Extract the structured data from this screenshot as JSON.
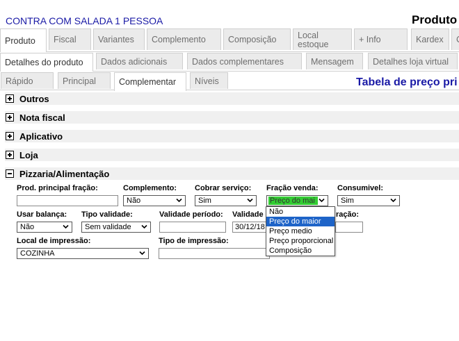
{
  "header": {
    "product_name": "CONTRA COM SALADA 1 PESSOA",
    "title": "Produto"
  },
  "main_tabs": [
    "Produto",
    "Fiscal",
    "Variantes",
    "Complemento",
    "Composição",
    "Local estoque",
    "+ Info",
    "Kardex",
    "C"
  ],
  "detail_tabs": [
    "Detalhes do produto",
    "Dados adicionais",
    "Dados complementares",
    "Mensagem",
    "Detalhes loja virtual"
  ],
  "sub_tabs": [
    "Rápido",
    "Principal",
    "Complementar",
    "Níveis"
  ],
  "price_table_title": "Tabela de preço pri",
  "sections": [
    "Outros",
    "Nota fiscal",
    "Aplicativo",
    "Loja",
    "Pizzaria/Alimentação"
  ],
  "pizzaria": {
    "labels": {
      "prod_principal_fracao": "Prod. principal fração:",
      "complemento": "Complemento:",
      "cobrar_servico": "Cobrar serviço:",
      "fracao_venda": "Fração venda:",
      "consumivel": "Consumivel:",
      "usar_balanca": "Usar balança:",
      "tipo_validade": "Tipo validade:",
      "validade_periodo": "Validade período:",
      "validade": "Validade",
      "geracao": "ração:",
      "local_impressao": "Local de impressão:",
      "tipo_impressao": "Tipo de impressão:"
    },
    "values": {
      "prod_principal_fracao": "",
      "complemento": "Não",
      "cobrar_servico": "Sim",
      "fracao_venda": "Preço do mai",
      "consumivel": "Sim",
      "usar_balanca": "Não",
      "tipo_validade": "Sem validade",
      "validade_periodo": "",
      "validade": "30/12/18",
      "geracao": "",
      "local_impressao": "COZINHA",
      "tipo_impressao": ""
    },
    "fracao_options": [
      "Não",
      "Preço do maior",
      "Preço medio",
      "Preço proporcional",
      "Composição"
    ],
    "fracao_highlighted": "Preço do maior"
  },
  "colors": {
    "title_blue": "#1a1aa6",
    "highlight_green": "#33cc33",
    "selection_blue": "#1e64c8"
  }
}
